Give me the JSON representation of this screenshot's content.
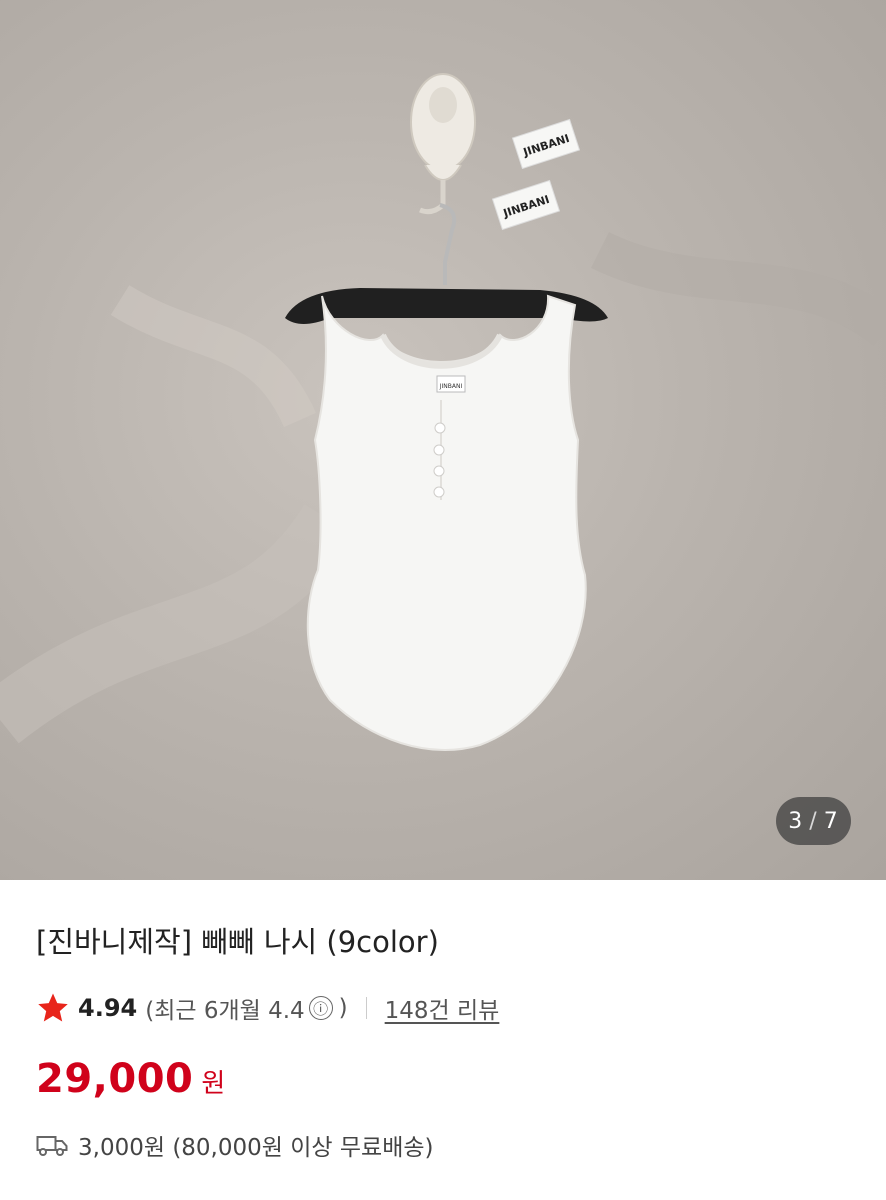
{
  "gallery": {
    "current": "3",
    "separator": "/",
    "total": "7",
    "tags": [
      "JINBANI",
      "JINBANI"
    ],
    "garment_label": "JINBANI"
  },
  "product": {
    "title": "[진바니제작] 빼빼 나시 (9color)",
    "rating": {
      "score": "4.94",
      "recent_label": "(최근 6개월 4.4",
      "recent_close": ")",
      "info_icon": "ⓘ",
      "review_count": "148건 리뷰"
    },
    "price": {
      "amount": "29,000",
      "unit": "원"
    },
    "shipping": {
      "icon": "truck-icon",
      "text": "3,000원 (80,000원 이상 무료배송)"
    }
  },
  "colors": {
    "price_red": "#d0021b",
    "star_red": "#e8251b",
    "background_wall": "#bab4ae"
  }
}
